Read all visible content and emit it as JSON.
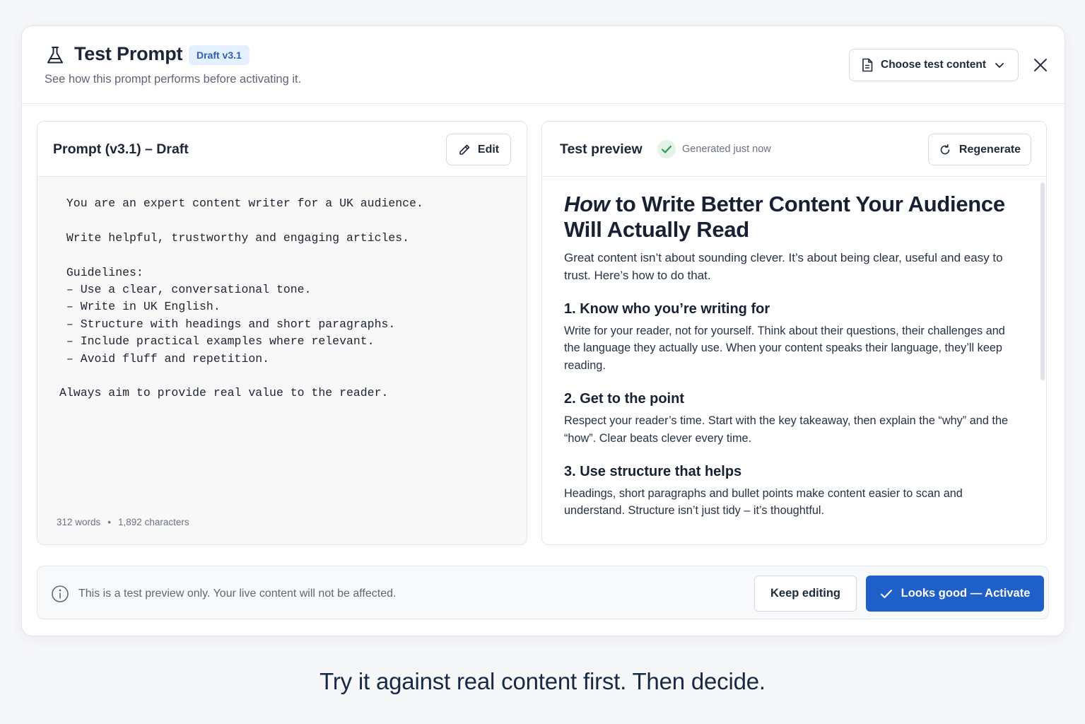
{
  "header": {
    "title": "Test Prompt",
    "badge": "Draft v3.1",
    "subtitle": "See how this prompt performs before activating it.",
    "choose_content_label": "Choose test content"
  },
  "prompt_panel": {
    "title": "Prompt (v3.1) – Draft",
    "edit_label": "Edit",
    "text": " You are an expert content writer for a UK audience.\n\n Write helpful, trustworthy and engaging articles.\n\n Guidelines:\n – Use a clear, conversational tone.\n – Write in UK English.\n – Structure with headings and short paragraphs.\n – Include practical examples where relevant.\n – Avoid fluff and repetition.\n\nAlways aim to provide real value to the reader.",
    "word_count": "312 words",
    "separator": "•",
    "char_count": "1,892 characters"
  },
  "preview_panel": {
    "title": "Test preview",
    "status": "Generated just now",
    "regenerate_label": "Regenerate",
    "article": {
      "title_italic": "How",
      "title_rest": " to Write Better Content Your Audience Will Actually Read",
      "intro": "Great content isn’t about sounding clever. It’s about being clear, useful and easy to trust. Here’s how to do that.",
      "sections": [
        {
          "heading": "1. Know who you’re writing for",
          "body": "Write for your reader, not for yourself. Think about their questions, their challenges and the language they actually use. When your content speaks their language, they’ll keep reading."
        },
        {
          "heading": "2. Get to the point",
          "body": "Respect your reader’s time. Start with the key takeaway, then explain the “why” and the “how”. Clear beats clever every time."
        },
        {
          "heading": "3. Use structure that helps",
          "body": "Headings, short paragraphs and bullet points make content easier to scan and understand. Structure isn’t just tidy – it’s thoughtful."
        }
      ]
    }
  },
  "footer": {
    "note": "This is a test preview only. Your live content will not be affected.",
    "keep_editing_label": "Keep editing",
    "activate_label": "Looks good — Activate"
  },
  "tagline": "Try it against real content first. Then decide.",
  "icons": {
    "title": "flask-icon",
    "choose": "document-icon",
    "dropdown": "chevron-down-icon",
    "close": "close-icon",
    "edit": "pencil-icon",
    "status": "check-icon",
    "regenerate": "refresh-icon",
    "info": "info-icon",
    "activate": "check-icon"
  },
  "colors": {
    "primary": "#1f5fc9",
    "badge_bg": "#e4efff",
    "badge_text": "#2b5fb8",
    "success": "#2e9b52"
  }
}
